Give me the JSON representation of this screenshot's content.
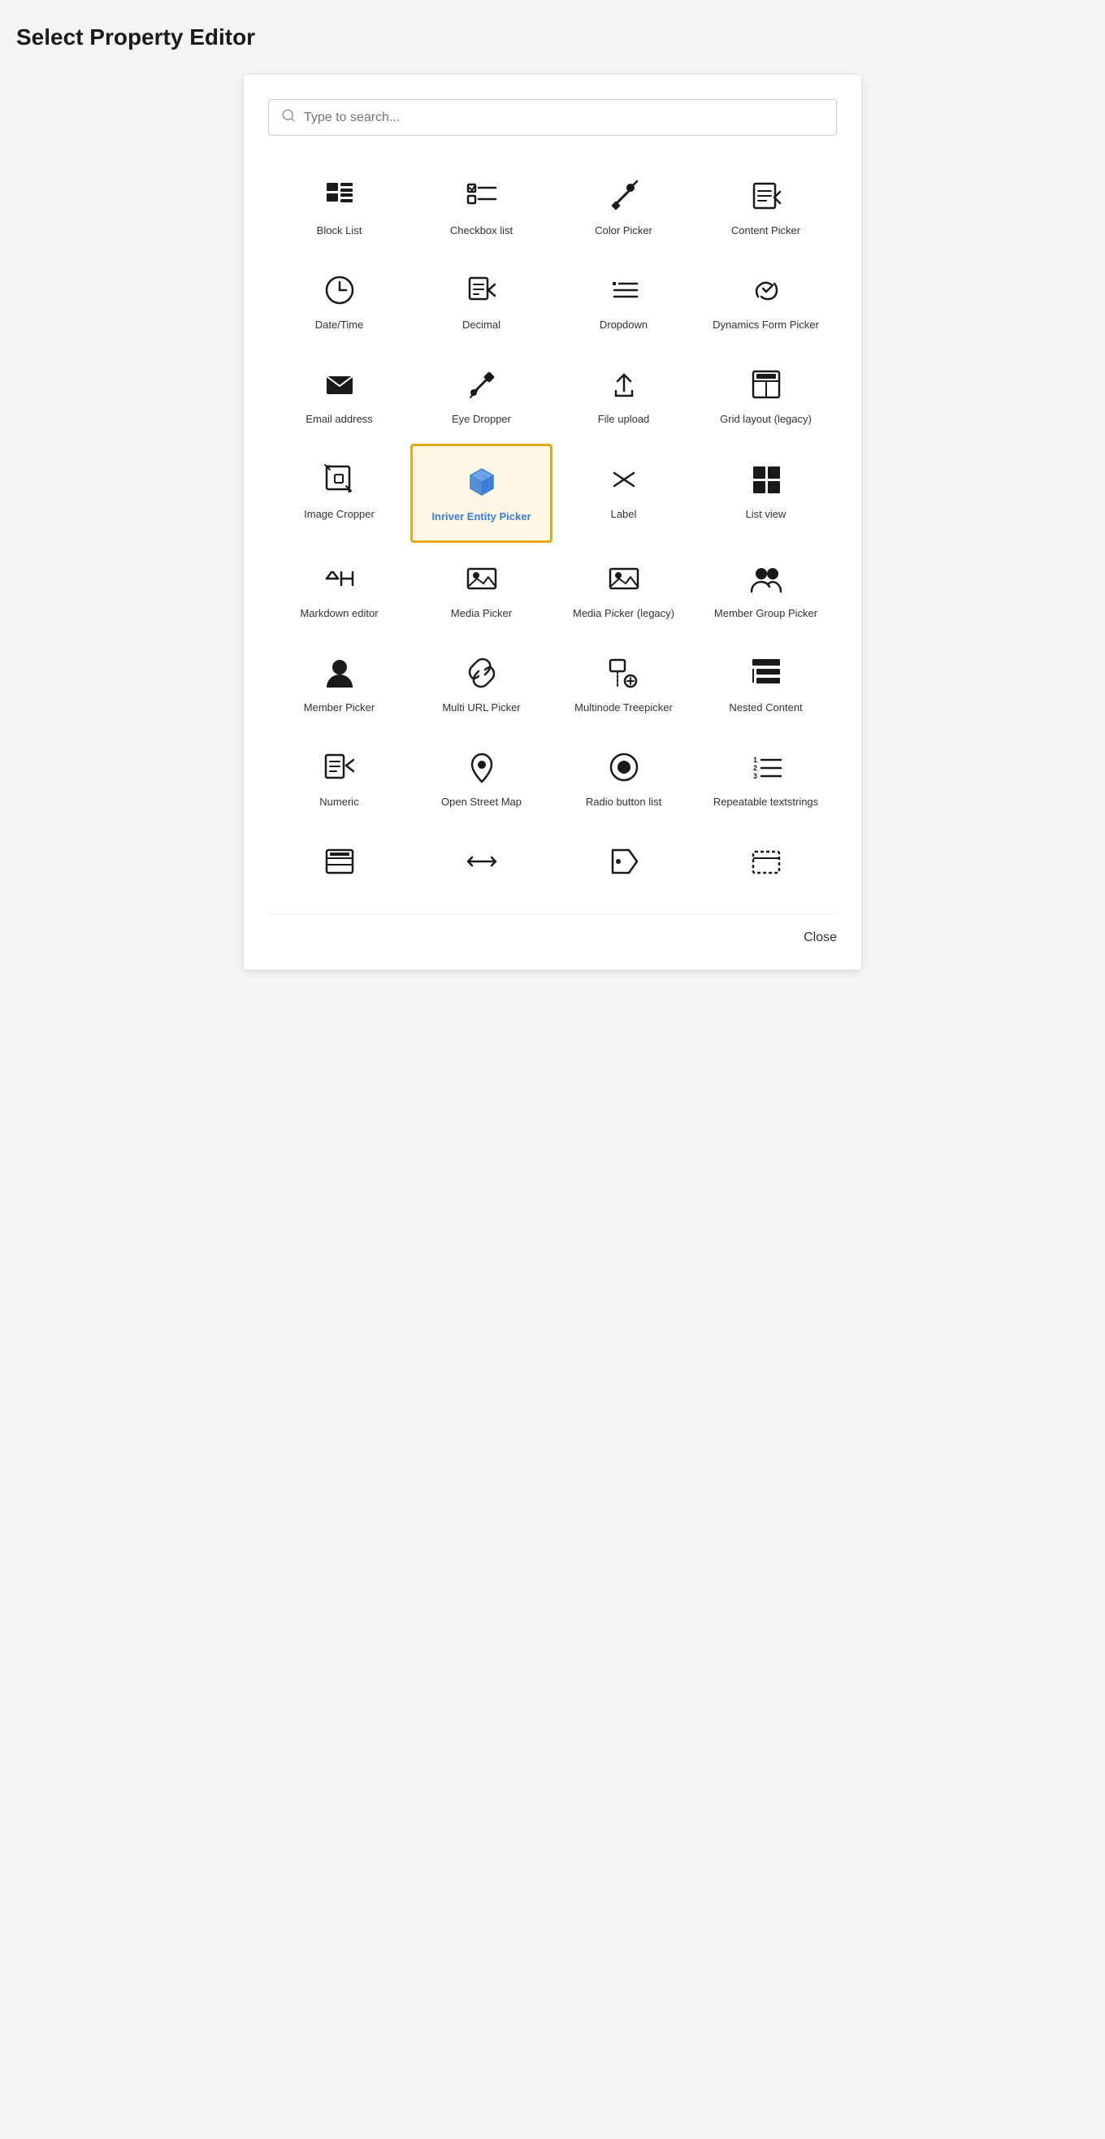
{
  "page": {
    "title": "Select Property Editor"
  },
  "search": {
    "placeholder": "Type to search..."
  },
  "items": [
    {
      "id": "block-list",
      "label": "Block List",
      "icon": "block-list"
    },
    {
      "id": "checkbox-list",
      "label": "Checkbox list",
      "icon": "checkbox-list"
    },
    {
      "id": "color-picker",
      "label": "Color Picker",
      "icon": "color-picker"
    },
    {
      "id": "content-picker",
      "label": "Content Picker",
      "icon": "content-picker"
    },
    {
      "id": "datetime",
      "label": "Date/Time",
      "icon": "datetime"
    },
    {
      "id": "decimal",
      "label": "Decimal",
      "icon": "decimal"
    },
    {
      "id": "dropdown",
      "label": "Dropdown",
      "icon": "dropdown"
    },
    {
      "id": "dynamics-form-picker",
      "label": "Dynamics Form Picker",
      "icon": "dynamics-form-picker"
    },
    {
      "id": "email-address",
      "label": "Email address",
      "icon": "email"
    },
    {
      "id": "eye-dropper",
      "label": "Eye Dropper",
      "icon": "eye-dropper"
    },
    {
      "id": "file-upload",
      "label": "File upload",
      "icon": "file-upload"
    },
    {
      "id": "grid-layout",
      "label": "Grid layout (legacy)",
      "icon": "grid-layout"
    },
    {
      "id": "image-cropper",
      "label": "Image Cropper",
      "icon": "image-cropper"
    },
    {
      "id": "inriver-entity-picker",
      "label": "Inriver Entity Picker",
      "icon": "inriver-entity-picker",
      "selected": true,
      "blue": true
    },
    {
      "id": "label",
      "label": "Label",
      "icon": "label"
    },
    {
      "id": "list-view",
      "label": "List view",
      "icon": "list-view"
    },
    {
      "id": "markdown-editor",
      "label": "Markdown editor",
      "icon": "markdown-editor"
    },
    {
      "id": "media-picker",
      "label": "Media Picker",
      "icon": "media-picker"
    },
    {
      "id": "media-picker-legacy",
      "label": "Media Picker (legacy)",
      "icon": "media-picker-legacy"
    },
    {
      "id": "member-group-picker",
      "label": "Member Group Picker",
      "icon": "member-group-picker"
    },
    {
      "id": "member-picker",
      "label": "Member Picker",
      "icon": "member-picker"
    },
    {
      "id": "multi-url-picker",
      "label": "Multi URL Picker",
      "icon": "multi-url-picker"
    },
    {
      "id": "multinode-treepicker",
      "label": "Multinode Treepicker",
      "icon": "multinode-treepicker"
    },
    {
      "id": "nested-content",
      "label": "Nested Content",
      "icon": "nested-content"
    },
    {
      "id": "numeric",
      "label": "Numeric",
      "icon": "numeric"
    },
    {
      "id": "open-street-map",
      "label": "Open Street Map",
      "icon": "open-street-map"
    },
    {
      "id": "radio-button-list",
      "label": "Radio button list",
      "icon": "radio-button-list"
    },
    {
      "id": "repeatable-textstrings",
      "label": "Repeatable textstrings",
      "icon": "repeatable-textstrings"
    },
    {
      "id": "row-1",
      "label": "",
      "icon": "form-row"
    },
    {
      "id": "row-2",
      "label": "",
      "icon": "arrow-row"
    },
    {
      "id": "row-3",
      "label": "",
      "icon": "tag-row"
    },
    {
      "id": "row-4",
      "label": "",
      "icon": "window-row"
    }
  ],
  "close_label": "Close"
}
